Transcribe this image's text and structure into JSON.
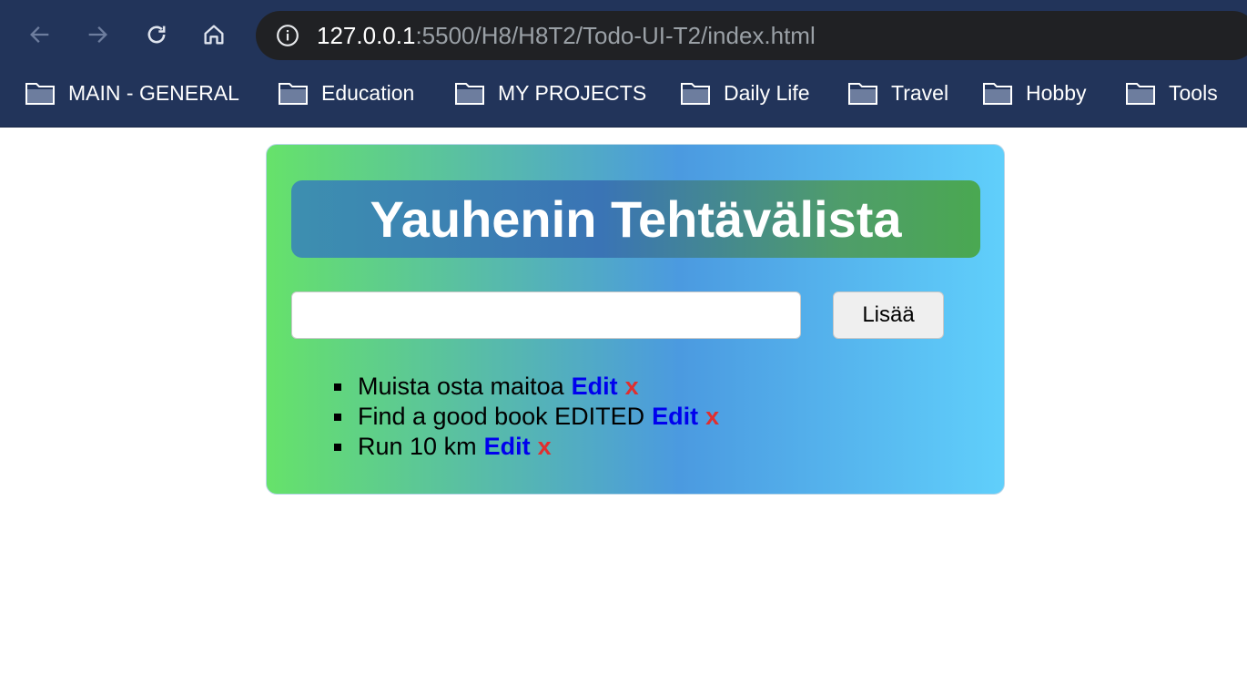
{
  "browser": {
    "url_host": "127.0.0.1",
    "url_rest": ":5500/H8/H8T2/Todo-UI-T2/index.html",
    "icons": [
      "back-arrow-icon",
      "forward-arrow-icon",
      "reload-icon",
      "home-icon",
      "info-icon",
      "folder-icon"
    ],
    "bookmarks": [
      "MAIN - GENERAL",
      "Education",
      "MY PROJECTS",
      "Daily Life",
      "Travel",
      "Hobby",
      "Tools"
    ]
  },
  "app": {
    "title": "Yauhenin Tehtävälista",
    "input_value": "",
    "add_label": "Lisää",
    "edit_label": "Edit",
    "delete_label": "x",
    "todos": [
      "Muista osta maitoa",
      "Find a good book EDITED",
      "Run 10 km"
    ]
  },
  "colors": {
    "chrome_bg": "#22345a",
    "url_bg": "#202124",
    "edit": "#0000ee",
    "delete": "#e02f2f",
    "card_gradient": [
      "#66e26a",
      "#4b9ae0",
      "#60cffb"
    ]
  }
}
